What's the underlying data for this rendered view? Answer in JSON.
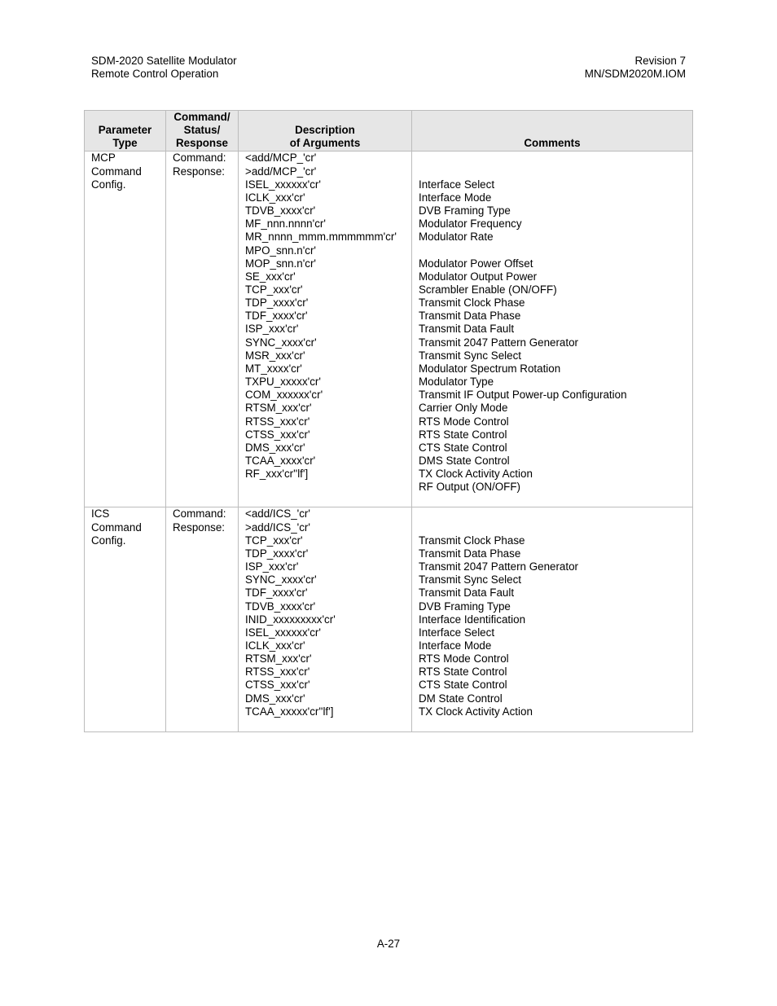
{
  "header": {
    "left": [
      "SDM-2020 Satellite Modulator",
      "Remote Control Operation"
    ],
    "right": [
      "Revision 7",
      "MN/SDM2020M.IOM"
    ]
  },
  "table": {
    "columns": [
      [
        "Parameter",
        "Type"
      ],
      [
        "Command/",
        "Status/",
        "Response"
      ],
      [
        "Description",
        "of Arguments"
      ],
      [
        "Comments"
      ]
    ],
    "rows": [
      {
        "type": [
          "MCP",
          "Command",
          "Config."
        ],
        "cmd": [
          "Command:",
          "Response:"
        ],
        "args": [
          "<add/MCP_'cr'",
          ">add/MCP_'cr'",
          "ISEL_xxxxxx'cr'",
          "ICLK_xxx'cr'",
          "TDVB_xxxx'cr'",
          "MF_nnn.nnnn'cr'",
          "MR_nnnn_mmm.mmmmmm'cr'",
          "MPO_snn.n'cr'",
          "MOP_snn.n'cr'",
          "SE_xxx'cr'",
          "TCP_xxx'cr'",
          "TDP_xxxx'cr'",
          "TDF_xxxx'cr'",
          "ISP_xxx'cr'",
          "SYNC_xxxx'cr'",
          "MSR_xxx'cr'",
          "MT_xxxx'cr'",
          "TXPU_xxxxx'cr'",
          "COM_xxxxxx'cr'",
          "RTSM_xxx'cr'",
          "RTSS_xxx'cr'",
          "CTSS_xxx'cr'",
          "DMS_xxx'cr'",
          "TCAA_xxxx'cr'",
          "RF_xxx'cr''lf']"
        ],
        "comments": [
          "",
          "",
          "Interface Select",
          "Interface Mode",
          "DVB Framing Type",
          "Modulator Frequency",
          "Modulator Rate",
          "",
          "Modulator Power Offset",
          "Modulator Output Power",
          "Scrambler Enable (ON/OFF)",
          "Transmit Clock Phase",
          "Transmit Data Phase",
          "Transmit Data Fault",
          "Transmit 2047 Pattern Generator",
          "Transmit Sync Select",
          "Modulator Spectrum Rotation",
          "Modulator Type",
          "Transmit IF Output Power-up Configuration",
          "Carrier Only Mode",
          "RTS Mode Control",
          "RTS State Control",
          "CTS State Control",
          "DMS State Control",
          "TX Clock Activity Action",
          "RF Output (ON/OFF)"
        ]
      },
      {
        "type": [
          "ICS",
          "Command",
          "Config."
        ],
        "cmd": [
          "Command:",
          "Response:"
        ],
        "args": [
          "<add/ICS_'cr'",
          ">add/ICS_'cr'",
          "TCP_xxx'cr'",
          "TDP_xxxx'cr'",
          "ISP_xxx'cr'",
          "SYNC_xxxx'cr'",
          "TDF_xxxx'cr'",
          "TDVB_xxxx'cr'",
          "INID_xxxxxxxxx'cr'",
          "ISEL_xxxxxx'cr'",
          "ICLK_xxx'cr'",
          "RTSM_xxx'cr'",
          "RTSS_xxx'cr'",
          "CTSS_xxx'cr'",
          "DMS_xxx'cr'",
          "TCAA_xxxxx'cr''lf']"
        ],
        "comments": [
          "",
          "",
          "Transmit Clock Phase",
          "Transmit Data Phase",
          "Transmit 2047 Pattern Generator",
          "Transmit Sync Select",
          "Transmit Data Fault",
          "DVB Framing Type",
          "Interface Identification",
          "Interface Select",
          "Interface Mode",
          "RTS Mode Control",
          "RTS State Control",
          "CTS State Control",
          "DM State Control",
          "TX Clock Activity Action"
        ]
      }
    ]
  },
  "footer": {
    "page": "A-27"
  }
}
